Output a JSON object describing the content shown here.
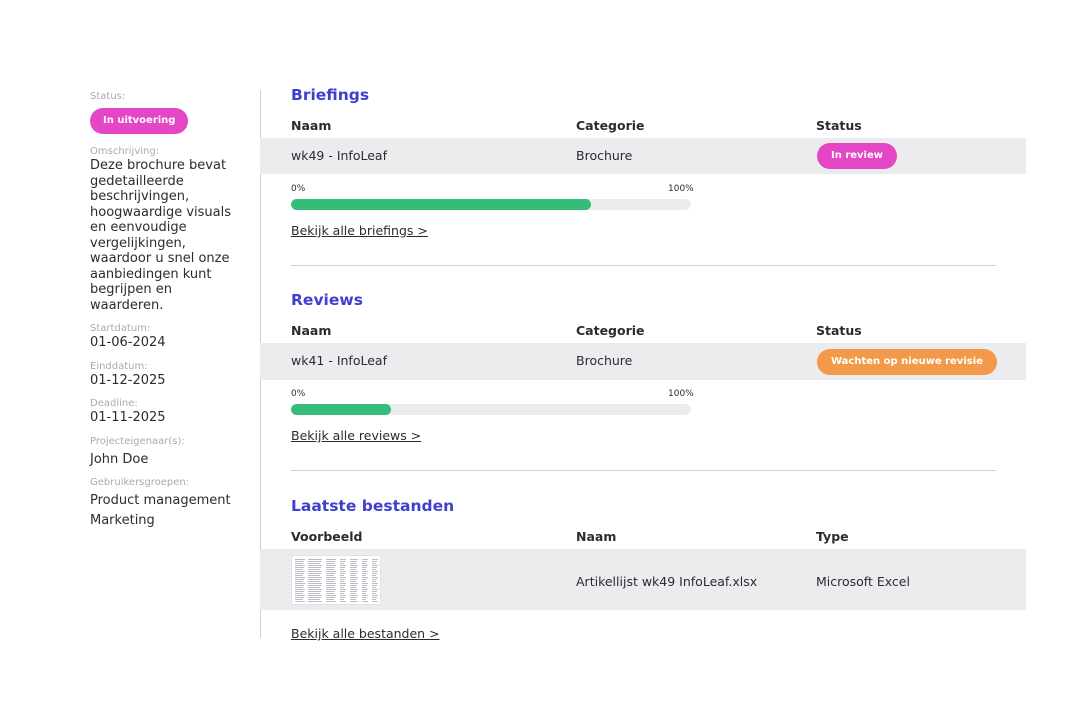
{
  "sidebar": {
    "status_label": "Status:",
    "status_value": "In uitvoering",
    "description_label": "Omschrijving:",
    "description_value": "Deze brochure bevat gedetailleerde beschrijvingen, hoogwaardige visuals en eenvoudige vergelijkingen, waardoor u snel onze aanbiedingen kunt begrijpen en waarderen.",
    "start_label": "Startdatum:",
    "start_value": "01-06-2024",
    "end_label": "Einddatum:",
    "end_value": "01-12-2025",
    "deadline_label": "Deadline:",
    "deadline_value": "01-11-2025",
    "owners_label": "Projecteigenaar(s):",
    "owners": [
      "John Doe"
    ],
    "groups_label": "Gebruikersgroepen:",
    "groups": [
      "Product management",
      "Marketing"
    ]
  },
  "briefings": {
    "title": "Briefings",
    "columns": [
      "Naam",
      "Categorie",
      "Status"
    ],
    "rows": [
      {
        "name": "wk49 - InfoLeaf",
        "category": "Brochure",
        "status": "In review"
      }
    ],
    "progress": {
      "min_label": "0%",
      "max_label": "100%",
      "value": 0.75
    },
    "link": "Bekijk alle briefings >"
  },
  "reviews": {
    "title": "Reviews",
    "columns": [
      "Naam",
      "Categorie",
      "Status"
    ],
    "rows": [
      {
        "name": "wk41 - InfoLeaf",
        "category": "Brochure",
        "status": "Wachten op nieuwe revisie"
      }
    ],
    "progress": {
      "min_label": "0%",
      "max_label": "100%",
      "value": 0.25
    },
    "link": "Bekijk alle reviews >"
  },
  "files": {
    "title": "Laatste bestanden",
    "columns": [
      "Voorbeeld",
      "Naam",
      "Type"
    ],
    "rows": [
      {
        "name": "Artikellijst wk49 InfoLeaf.xlsx",
        "type": "Microsoft Excel"
      }
    ],
    "link": "Bekijk alle bestanden >"
  },
  "colors": {
    "accent": "#3f3fcf",
    "status_in_progress": "#e546c6",
    "status_in_review": "#e546c6",
    "status_waiting": "#f39a4a",
    "progress_fill": "#34bc78"
  }
}
